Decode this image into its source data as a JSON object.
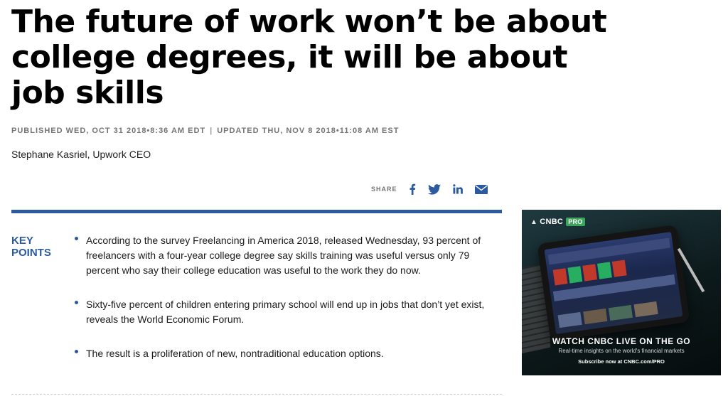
{
  "article": {
    "headline": "The future of work won’t be about college degrees, it will be about job skills",
    "published": "PUBLISHED WED, OCT 31 2018•8:36 AM EDT",
    "updated": "UPDATED THU, NOV 8 2018•11:08 AM EST",
    "timestamp_separator": "|",
    "byline": "Stephane Kasriel, Upwork CEO"
  },
  "share": {
    "label": "SHARE",
    "icons": [
      "facebook-icon",
      "twitter-icon",
      "linkedin-icon",
      "email-icon"
    ]
  },
  "key_points": {
    "label_line1": "KEY",
    "label_line2": "POINTS",
    "items": [
      "According to the survey Freelancing in America 2018, released Wednesday, 93 percent of freelancers with a four-year college degree say skills training was useful versus only 79 percent who say their college education was useful to the work they do now.",
      "Sixty-five percent of children entering primary school will end up in jobs that don’t yet exist, reveals the World Economic Forum.",
      "The result is a proliferation of new, nontraditional education options."
    ]
  },
  "ad": {
    "logo_text": "CNBC",
    "logo_badge": "PRO",
    "headline": "WATCH CNBC LIVE ON THE GO",
    "subline": "Real-time insights on the world's financial markets",
    "cta": "Subscribe now at CNBC.com/PRO"
  },
  "colors": {
    "accent": "#2c5aa0",
    "meta_text": "#747474",
    "pro_badge": "#3ba55c"
  }
}
